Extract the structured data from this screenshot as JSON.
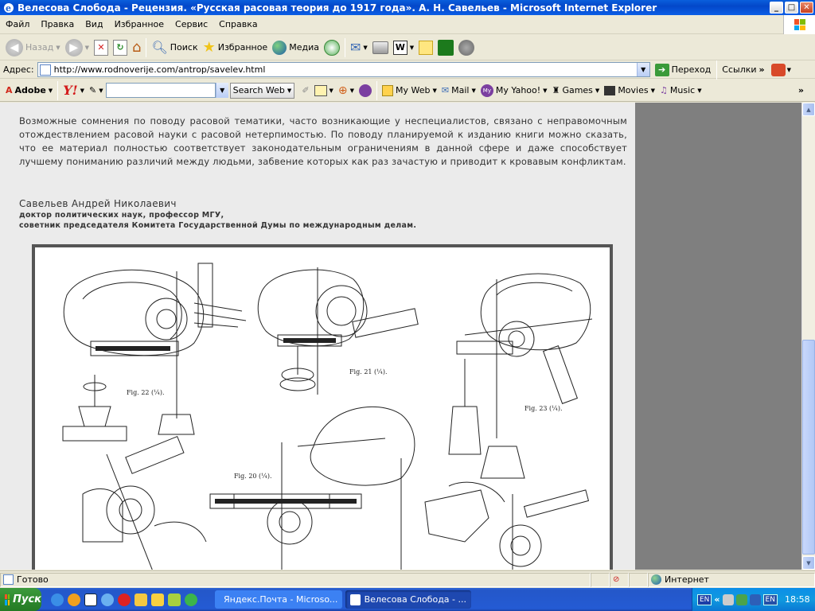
{
  "window": {
    "title": "Велесова Слобода - Рецензия. «Русская расовая теория до 1917 года». А. Н. Савельев - Microsoft Internet Explorer",
    "min": "_",
    "max": "□",
    "close": "✕"
  },
  "menu": [
    "Файл",
    "Правка",
    "Вид",
    "Избранное",
    "Сервис",
    "Справка"
  ],
  "toolbar": {
    "back": "Назад",
    "search": "Поиск",
    "favorites": "Избранное",
    "media": "Медиа"
  },
  "address": {
    "label": "Адрес:",
    "url": "http://www.rodnoverije.com/antrop/savelev.html",
    "go": "Переход",
    "links": "Ссылки"
  },
  "yahoo_bar": {
    "adobe": "Adobe",
    "yahoo": "Y!",
    "search_web": "Search Web",
    "my_web": "My Web",
    "mail": "Mail",
    "my_yahoo": "My Yahoo!",
    "games": "Games",
    "movies": "Movies",
    "music": "Music"
  },
  "article": {
    "paragraph": "Возможные сомнения по поводу расовой тематики, часто возникающие у неспециалистов, связано с неправомочным отождествлением расовой науки с расовой нетерпимостью. По поводу планируемой к изданию книги можно сказать, что ее материал полностью соответствует законодательным ограничениям в данной сфере и даже способствует лучшему пониманию различий между людьми, забвение которых как раз зачастую и приводит к кровавым конфликтам.",
    "author": "Савельев Андрей Николаевич",
    "credentials": [
      "доктор политических наук, профессор МГУ,",
      "советник председателя Комитета Государственной Думы по международным делам."
    ]
  },
  "figure": {
    "captions": [
      "Fig. 22 (¼).",
      "Fig. 21 (¼).",
      "Fig. 23 (¼).",
      "Fig. 20 (¼)."
    ]
  },
  "status": {
    "text": "Готово",
    "zone": "Интернет"
  },
  "taskbar": {
    "start": "Пуск",
    "tasks": [
      "Яндекс.Почта - Microso...",
      "Велесова Слобода - ..."
    ],
    "lang": "EN",
    "lang2": "EN",
    "time": "18:58"
  }
}
